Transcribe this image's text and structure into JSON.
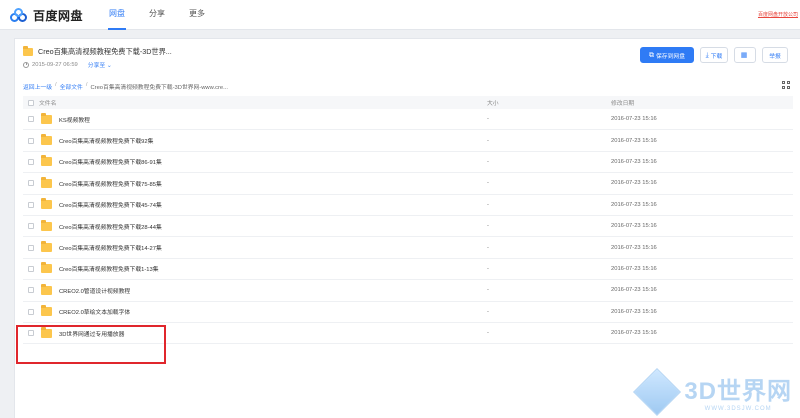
{
  "topbar": {
    "logo_text": "百度网盘",
    "nav": [
      {
        "label": "网盘",
        "active": true
      },
      {
        "label": "分享",
        "active": false
      },
      {
        "label": "更多",
        "active": false
      }
    ],
    "right_link": "百度网盘开放公司"
  },
  "share": {
    "title": "Creo百集高清视频教程免费下载-3D世界...",
    "date": "2015-09-27 06:59",
    "owner_label": "分享至"
  },
  "actions": {
    "save_label": "保存到网盘",
    "download_label": "下载",
    "report_label": "举报"
  },
  "breadcrumb": {
    "back": "返回上一级",
    "all": "全部文件",
    "sep": "/",
    "current": "Creo百集高清视频教程免费下载-3D世界网-www.cre..."
  },
  "table": {
    "headers": {
      "name": "文件名",
      "size": "大小",
      "date": "修改日期"
    },
    "rows": [
      {
        "name": "KS视频教程",
        "size": "-",
        "date": "2016-07-23 15:16"
      },
      {
        "name": "Creo百集高清视频教程免费下载92集",
        "size": "-",
        "date": "2016-07-23 15:16"
      },
      {
        "name": "Creo百集高清视频教程免费下载86-91集",
        "size": "-",
        "date": "2016-07-23 15:16"
      },
      {
        "name": "Creo百集高清视频教程免费下载75-85集",
        "size": "-",
        "date": "2016-07-23 15:16"
      },
      {
        "name": "Creo百集高清视频教程免费下载45-74集",
        "size": "-",
        "date": "2016-07-23 15:16"
      },
      {
        "name": "Creo百集高清视频教程免费下载28-44集",
        "size": "-",
        "date": "2016-07-23 15:16"
      },
      {
        "name": "Creo百集高清视频教程免费下载14-27集",
        "size": "-",
        "date": "2016-07-23 15:16"
      },
      {
        "name": "Creo百集高清视频教程免费下载1-13集",
        "size": "-",
        "date": "2016-07-23 15:16"
      },
      {
        "name": "CREO2.0管道设计视频教程",
        "size": "-",
        "date": "2016-07-23 15:16"
      },
      {
        "name": "CREO2.0草绘文本加载字体",
        "size": "-",
        "date": "2016-07-23 15:16"
      },
      {
        "name": "3D世界网通过专用播放器",
        "size": "-",
        "date": "2016-07-23 15:16"
      }
    ]
  },
  "watermark": {
    "title": "3D世界网",
    "sub": "WWW.3DSJW.COM"
  },
  "colors": {
    "accent": "#2f7bf5",
    "highlight": "#e0262c",
    "folder": "#fcc64d"
  }
}
